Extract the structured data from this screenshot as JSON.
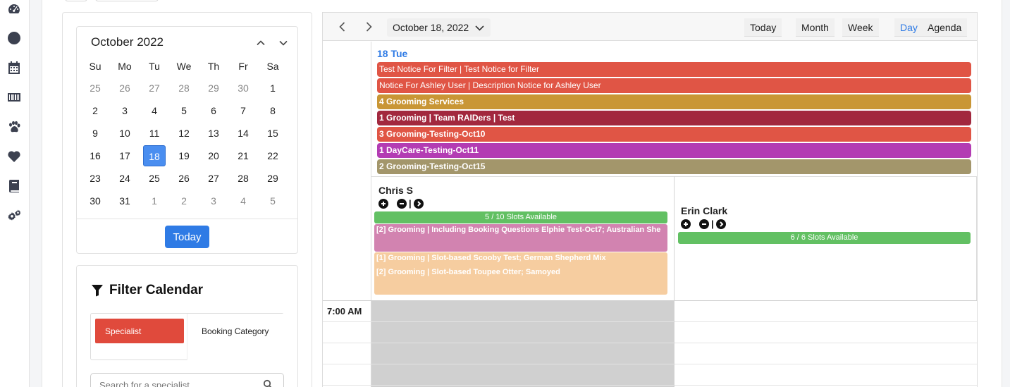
{
  "sidebar": {
    "icons": [
      "dashboard-icon",
      "clock-icon",
      "calendar-icon",
      "barcode-icon",
      "paw-icon",
      "heart-icon",
      "book-icon",
      "settings-icon"
    ]
  },
  "mini_calendar": {
    "title": "October 2022",
    "weekdays": [
      "Su",
      "Mo",
      "Tu",
      "We",
      "Th",
      "Fr",
      "Sa"
    ],
    "weeks": [
      [
        "25",
        "26",
        "27",
        "28",
        "29",
        "30",
        "1"
      ],
      [
        "2",
        "3",
        "4",
        "5",
        "6",
        "7",
        "8"
      ],
      [
        "9",
        "10",
        "11",
        "12",
        "13",
        "14",
        "15"
      ],
      [
        "16",
        "17",
        "18",
        "19",
        "20",
        "21",
        "22"
      ],
      [
        "23",
        "24",
        "25",
        "26",
        "27",
        "28",
        "29"
      ],
      [
        "30",
        "31",
        "1",
        "2",
        "3",
        "4",
        "5"
      ]
    ],
    "today_label": "Today"
  },
  "filter": {
    "title": "Filter Calendar",
    "option_specialist": "Specialist",
    "option_category": "Booking Category",
    "search_placeholder": "Search for a specialist..."
  },
  "calendar": {
    "date_label": "October 18, 2022",
    "views": [
      "Today",
      "Month",
      "Week",
      "Day",
      "Agenda"
    ],
    "active_view": "Day",
    "day_label": "18 Tue",
    "all_day_events": [
      {
        "text": "Test Notice For Filter | Test Notice for Filter",
        "color": "#e05545",
        "bold": false
      },
      {
        "text": "Notice For Ashley User | Description Notice for Ashley User",
        "color": "#e05545",
        "bold": false
      },
      {
        "text": "4 Grooming Services",
        "color": "#c99635",
        "bold": true
      },
      {
        "text": "1 Grooming | Team RAIDers | Test",
        "color": "#a2283e",
        "bold": true
      },
      {
        "text": "3 Grooming-Testing-Oct10",
        "color": "#e05545",
        "bold": true
      },
      {
        "text": "1 DayCare-Testing-Oct11",
        "color": "#b33cb3",
        "bold": true
      },
      {
        "text": "2 Grooming-Testing-Oct15",
        "color": "#a3966b",
        "bold": true
      }
    ],
    "resources": [
      {
        "name": "Chris S",
        "slots": "5 / 10 Slots Available",
        "events": [
          {
            "text": "[2] Grooming | Including Booking Questions Elphie Test-Oct7; Australian She",
            "color": "#d283b0"
          },
          {
            "text": "[1] Grooming | Slot-based Scooby Test; German Shepherd Mix",
            "color": "#f6cda0"
          },
          {
            "text": "[2] Grooming | Slot-based Toupee Otter; Samoyed",
            "color": "#f6cda0"
          }
        ]
      },
      {
        "name": "Erin Clark",
        "slots": "6 / 6 Slots Available",
        "events": []
      }
    ],
    "time_label": "7:00 AM",
    "separator": "|"
  }
}
